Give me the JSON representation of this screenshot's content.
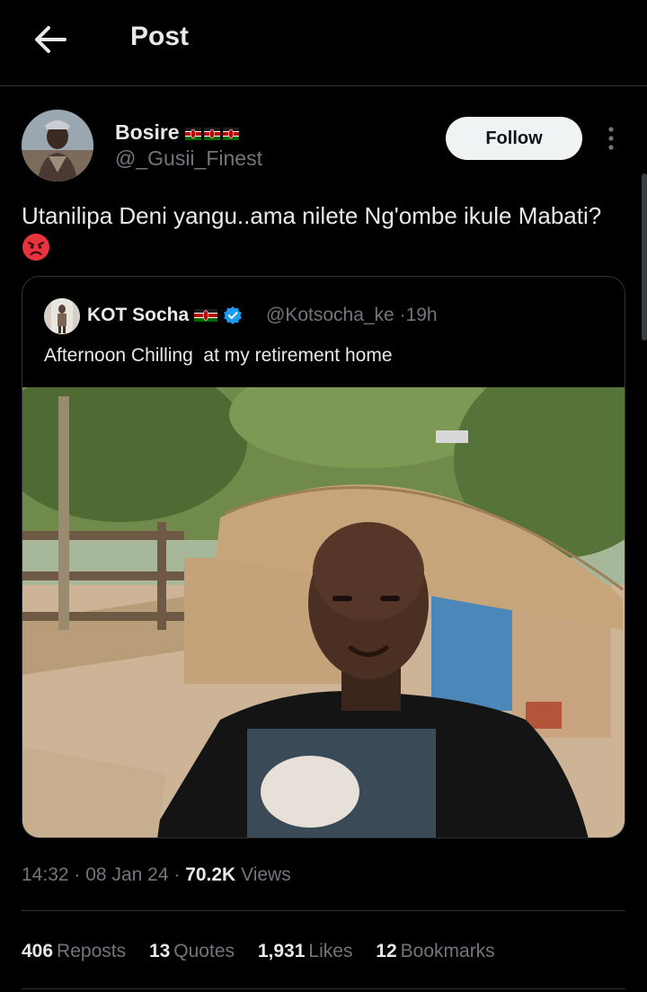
{
  "header": {
    "title": "Post",
    "back_icon": "arrow-left-icon"
  },
  "author": {
    "name": "Bosire",
    "handle": "@_Gusii_Finest",
    "flags": [
      "kenya-flag-icon",
      "kenya-flag-icon",
      "kenya-flag-icon"
    ],
    "follow_label": "Follow"
  },
  "tweet": {
    "text": "Utanilipa Deni yangu..ama nilete Ng'ombe ikule Mabati?",
    "emoji": "angry-face-icon"
  },
  "quote": {
    "name": "KOT Socha",
    "flag": "kenya-flag-icon",
    "verified_icon": "verified-badge-icon",
    "handle": "@Kotsocha_ke",
    "separator": "·",
    "time": "19h",
    "text": "Afternoon Chilling  at my retirement home"
  },
  "meta": {
    "time": "14:32",
    "date": "08 Jan 24",
    "views_count": "70.2K",
    "views_label": "Views",
    "separator": "·"
  },
  "stats": [
    {
      "count": "406",
      "label": "Reposts"
    },
    {
      "count": "13",
      "label": "Quotes"
    },
    {
      "count": "1,931",
      "label": "Likes"
    },
    {
      "count": "12",
      "label": "Bookmarks"
    }
  ],
  "colors": {
    "background": "#000000",
    "text_primary": "#e7e9ea",
    "text_secondary": "#71767b",
    "divider": "#2f3336",
    "verified": "#1d9bf0",
    "follow_bg": "#eff3f4"
  }
}
